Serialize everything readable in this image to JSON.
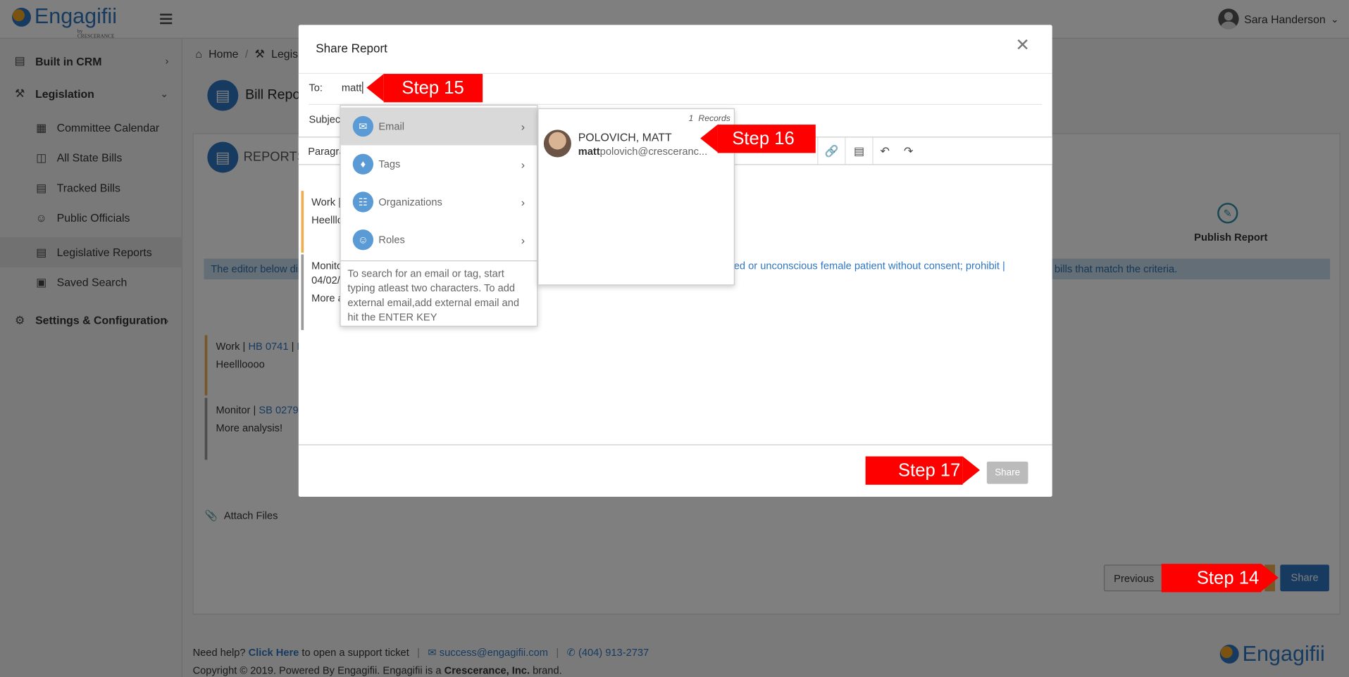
{
  "app": {
    "logo_text": "Engagifii",
    "logo_sub": "by CRESCERANCE",
    "user_name": "Sara Handerson"
  },
  "sidebar": {
    "items": [
      {
        "label": "Built in CRM",
        "icon": "crm-icon"
      },
      {
        "label": "Legislation",
        "icon": "gavel-icon"
      },
      {
        "label": "Committee Calendar",
        "icon": "calendar-icon"
      },
      {
        "label": "All State Bills",
        "icon": "bills-icon"
      },
      {
        "label": "Tracked Bills",
        "icon": "document-icon"
      },
      {
        "label": "Public Officials",
        "icon": "people-icon"
      },
      {
        "label": "Legislative Reports",
        "icon": "report-icon"
      },
      {
        "label": "Saved Search",
        "icon": "save-search-icon"
      },
      {
        "label": "Settings & Configuration",
        "icon": "gears-icon"
      }
    ]
  },
  "main": {
    "breadcrumb_home": "Home",
    "breadcrumb_sep": "/",
    "breadcrumb_next": "Legisl",
    "page_title": "Bill Repor",
    "section_title": "REPORTS",
    "step_label": "Publish Report",
    "banner_left": "The editor below dis",
    "banner_right": "ll bills that match the criteria.",
    "notes": [
      {
        "prefix": "Work |",
        "link": "HB 0741",
        "sep": "|",
        "link2": "E",
        "body": "Heellloooo"
      },
      {
        "prefix": "Monitor |",
        "link": "SB 0279",
        "sep": "|",
        "body": "More analysis!"
      }
    ],
    "attach_files": "Attach Files",
    "previous_label": "Previous",
    "share_label": "Share"
  },
  "modal": {
    "title": "Share Report",
    "to_label": "To:",
    "to_value": "matt",
    "subject_label": "Subject",
    "paragraph_label": "Paragra",
    "editor_lines": [
      {
        "a": "Work |",
        "b": "Heelllo"
      },
      {
        "a": "Monito",
        "b": "04/02/",
        "c": "More a",
        "link": "ed or unconscious female patient without consent; prohibit |"
      }
    ],
    "share_label": "Share"
  },
  "dropdown": {
    "items": [
      {
        "label": "Email",
        "icon": "email-icon"
      },
      {
        "label": "Tags",
        "icon": "tag-icon"
      },
      {
        "label": "Organizations",
        "icon": "organization-icon"
      },
      {
        "label": "Roles",
        "icon": "roles-icon"
      }
    ],
    "help_text": "To search for an email or tag, start typing atleast two characters. To add external email,add external email and hit the ENTER KEY"
  },
  "results": {
    "count": "1",
    "count_label": "Records",
    "name": "POLOVICH, MATT",
    "email_bold": "matt",
    "email_rest": "polovich@cresceranc..."
  },
  "callouts": {
    "step14": "Step 14",
    "step15": "Step 15",
    "step16": "Step 16",
    "step17": "Step 17"
  },
  "footer": {
    "need_help": "Need help?",
    "click_here": "Click Here",
    "support_text": "to open a support ticket",
    "email": "success@engagifii.com",
    "phone": "(404) 913-2737",
    "copyright_pre": "Copyright © 2019. Powered By Engagifii. Engagifii is a",
    "company": "Crescerance, Inc.",
    "copyright_post": "brand."
  }
}
